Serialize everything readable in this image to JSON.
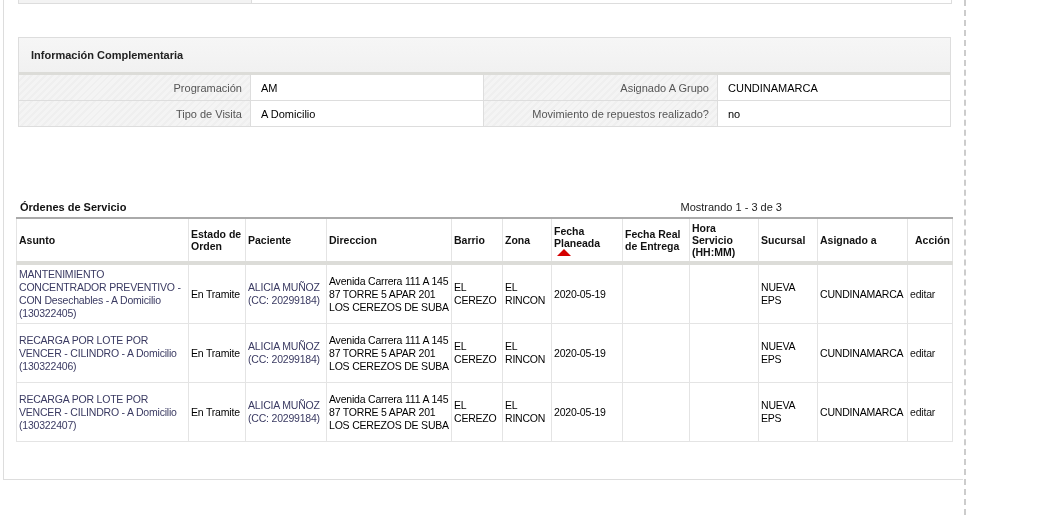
{
  "info_section": {
    "title": "Información Complementaria",
    "rows": [
      {
        "fields": [
          {
            "label": "Programación",
            "value": "AM"
          },
          {
            "label": "Asignado A Grupo",
            "value": "CUNDINAMARCA"
          }
        ]
      },
      {
        "fields": [
          {
            "label": "Tipo de Visita",
            "value": "A Domicilio"
          },
          {
            "label": "Movimiento de repuestos realizado?",
            "value": "no"
          }
        ]
      }
    ]
  },
  "orders": {
    "title": "Órdenes de Servicio",
    "pager": "Mostrando 1 - 3 de 3",
    "columns": [
      {
        "label": "Asunto",
        "kind": "link",
        "sorted": false
      },
      {
        "label": "Estado de Orden",
        "kind": "text",
        "sorted": false
      },
      {
        "label": "Paciente",
        "kind": "link",
        "sorted": false
      },
      {
        "label": "Direccion",
        "kind": "text",
        "sorted": false
      },
      {
        "label": "Barrio",
        "kind": "text",
        "sorted": false
      },
      {
        "label": "Zona",
        "kind": "text",
        "sorted": false
      },
      {
        "label": "Fecha Planeada",
        "kind": "text",
        "sorted": true
      },
      {
        "label": "Fecha Real de Entrega",
        "kind": "text",
        "sorted": false
      },
      {
        "label": "Hora Servicio (HH:MM)",
        "kind": "text",
        "sorted": false
      },
      {
        "label": "Sucursal",
        "kind": "text",
        "sorted": false
      },
      {
        "label": "Asignado a",
        "kind": "text",
        "sorted": false
      },
      {
        "label": "Acción",
        "kind": "action",
        "sorted": false
      }
    ],
    "rows": [
      {
        "cells": [
          "MANTENIMIENTO CONCENTRADOR PREVENTIVO - CON Desechables - A Domicilio (130322405)",
          "En Tramite",
          "ALICIA MUÑOZ (CC: 20299184)",
          "Avenida Carrera 111 A 145 87 TORRE 5 APAR 201 LOS CEREZOS DE SUBA",
          "EL CEREZO",
          "EL RINCON",
          "2020-05-19",
          "",
          "",
          "NUEVA EPS",
          "CUNDINAMARCA",
          "editar"
        ]
      },
      {
        "cells": [
          "RECARGA POR LOTE POR VENCER - CILINDRO - A Domicilio (130322406)",
          "En Tramite",
          "ALICIA MUÑOZ (CC: 20299184)",
          "Avenida Carrera 111 A 145 87 TORRE 5 APAR 201 LOS CEREZOS DE SUBA",
          "EL CEREZO",
          "EL RINCON",
          "2020-05-19",
          "",
          "",
          "NUEVA EPS",
          "CUNDINAMARCA",
          "editar"
        ]
      },
      {
        "cells": [
          "RECARGA POR LOTE POR VENCER - CILINDRO - A Domicilio (130322407)",
          "En Tramite",
          "ALICIA MUÑOZ (CC: 20299184)",
          "Avenida Carrera 111 A 145 87 TORRE 5 APAR 201 LOS CEREZOS DE SUBA",
          "EL CEREZO",
          "EL RINCON",
          "2020-05-19",
          "",
          "",
          "NUEVA EPS",
          "CUNDINAMARCA",
          "editar"
        ]
      }
    ]
  }
}
